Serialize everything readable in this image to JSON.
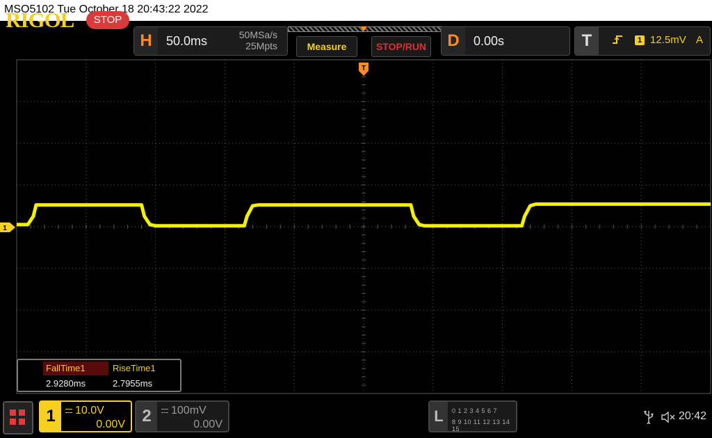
{
  "window": {
    "title": "MSO5102  Tue October 18 20:43:22 2022"
  },
  "top_bar": {
    "logo": "RIGOL",
    "run_status": "STOP",
    "horizontal": {
      "letter": "H",
      "timebase": "50.0ms",
      "sample_rate": "50MSa/s",
      "memory_depth": "25Mpts"
    },
    "measure_button": "Measure",
    "stoprun_button": "STOP/RUN",
    "delay": {
      "letter": "D",
      "value": "0.00s"
    },
    "trigger": {
      "letter": "T",
      "edge_icon": "rising-edge-icon",
      "source": "1",
      "level": "12.5mV",
      "mode": "A"
    }
  },
  "display": {
    "trigger_marker": "T",
    "channel1_marker": "1",
    "trace_color": "#f5f000",
    "grid_color": "#5a5a5a"
  },
  "trace_data": {
    "type": "line",
    "xlabel": "",
    "ylabel": "",
    "x_range_ms": [
      -250,
      250
    ],
    "y_range_V": [
      -40,
      40
    ],
    "series": [
      {
        "values_x_ms": [
          -250,
          -242,
          -238,
          -236,
          -160,
          -158,
          -154,
          -150,
          -86,
          -84,
          -80,
          -76,
          0,
          34,
          36,
          40,
          44,
          114,
          116,
          120,
          124,
          194,
          196,
          200,
          204,
          250
        ],
        "values_y_V": [
          0.5,
          0.5,
          2.5,
          5.2,
          5.2,
          2.5,
          0.5,
          0.2,
          0.2,
          2.5,
          5.0,
          5.2,
          5.2,
          5.2,
          2.5,
          0.5,
          0.2,
          0.2,
          2.5,
          5.0,
          5.4,
          5.4,
          5.4,
          5.4,
          5.4,
          5.4
        ]
      }
    ]
  },
  "measurements": {
    "items": [
      {
        "label": "FallTime1",
        "value": "2.9280ms"
      },
      {
        "label": "RiseTime1",
        "value": "2.7955ms"
      }
    ]
  },
  "bottom_bar": {
    "ch1": {
      "number": "1",
      "scale": "10.0V",
      "offset": "0.00V"
    },
    "ch2": {
      "number": "2",
      "scale": "100mV",
      "offset": "0.00V"
    },
    "logic": {
      "letter": "L",
      "row1": "0 1 2 3  4 5 6 7",
      "row2": "8 9 10 11 12 13 14 15"
    },
    "usb_icon": "usb-icon",
    "sound_icon": "speaker-muted-icon",
    "time": "20:42"
  }
}
